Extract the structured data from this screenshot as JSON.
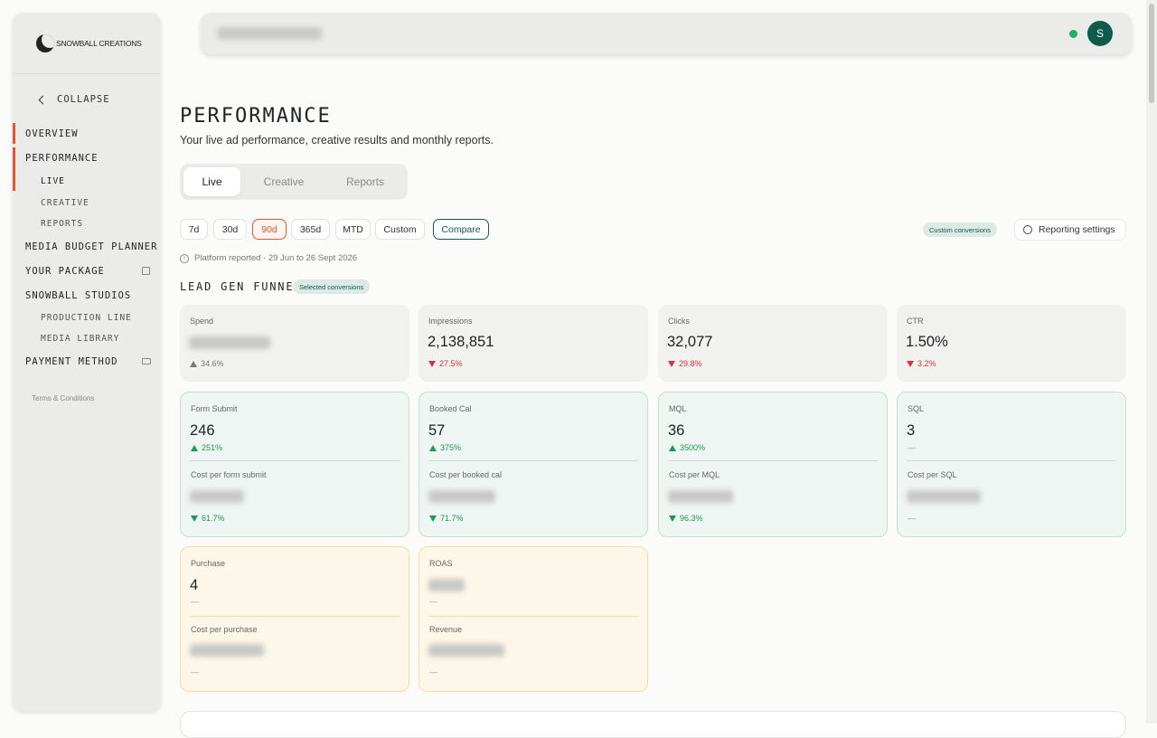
{
  "brand": {
    "name": "SNOWBALL CREATIONS"
  },
  "sidebar": {
    "collapse_label": "COLLAPSE",
    "items": [
      {
        "label": "OVERVIEW"
      },
      {
        "label": "PERFORMANCE"
      },
      {
        "label": "LIVE"
      },
      {
        "label": "CREATIVE"
      },
      {
        "label": "REPORTS"
      },
      {
        "label": "MEDIA BUDGET PLANNER"
      },
      {
        "label": "YOUR PACKAGE"
      },
      {
        "label": "SNOWBALL STUDIOS"
      },
      {
        "label": "PRODUCTION LINE"
      },
      {
        "label": "MEDIA LIBRARY"
      },
      {
        "label": "PAYMENT METHOD"
      }
    ],
    "terms": "Terms & Conditions"
  },
  "topbar": {
    "avatar_initial": "S",
    "online_color": "#1fb15c"
  },
  "page": {
    "title": "PERFORMANCE",
    "subtitle": "Your live ad performance, creative results and monthly reports.",
    "tabs": [
      "Live",
      "Creative",
      "Reports"
    ],
    "ranges": [
      "7d",
      "30d",
      "90d",
      "365d",
      "MTD",
      "Custom"
    ],
    "compare_label": "Compare",
    "custom_conversions": "Custom conversions",
    "reporting_settings": "Reporting settings",
    "platform_note": "Platform reported · 29 Jun to 26 Sept 2026",
    "funnel_title": "LEAD GEN FUNNEL",
    "selected_conversions": "Selected conversions",
    "accent_color": "#e3542f",
    "brand_green": "#0f5a4a"
  },
  "metrics": {
    "spend": {
      "label": "Spend",
      "change": "34.6%"
    },
    "impressions": {
      "label": "Impressions",
      "value": "2,138,851",
      "change": "27.5%"
    },
    "clicks": {
      "label": "Clicks",
      "value": "32,077",
      "change": "29.8%"
    },
    "ctr": {
      "label": "CTR",
      "value": "1.50%",
      "change": "3.2%"
    },
    "form_submit": {
      "label": "Form Submit",
      "value": "246",
      "change": "251%",
      "cost_label": "Cost per form submit",
      "cost_change": "61.7%"
    },
    "booked_cal": {
      "label": "Booked Cal",
      "value": "57",
      "change": "375%",
      "cost_label": "Cost per booked cal",
      "cost_change": "71.7%"
    },
    "mql": {
      "label": "MQL",
      "value": "36",
      "change": "3500%",
      "cost_label": "Cost per MQL",
      "cost_change": "96.3%"
    },
    "sql": {
      "label": "SQL",
      "value": "3",
      "change": "—",
      "cost_label": "Cost per SQL",
      "cost_change": "—"
    },
    "purchase": {
      "label": "Purchase",
      "value": "4",
      "change": "—",
      "cost_label": "Cost per purchase",
      "cost_change": "—"
    },
    "roas": {
      "label": "ROAS",
      "change": "—",
      "cost_label": "Revenue",
      "cost_change": "—"
    }
  }
}
